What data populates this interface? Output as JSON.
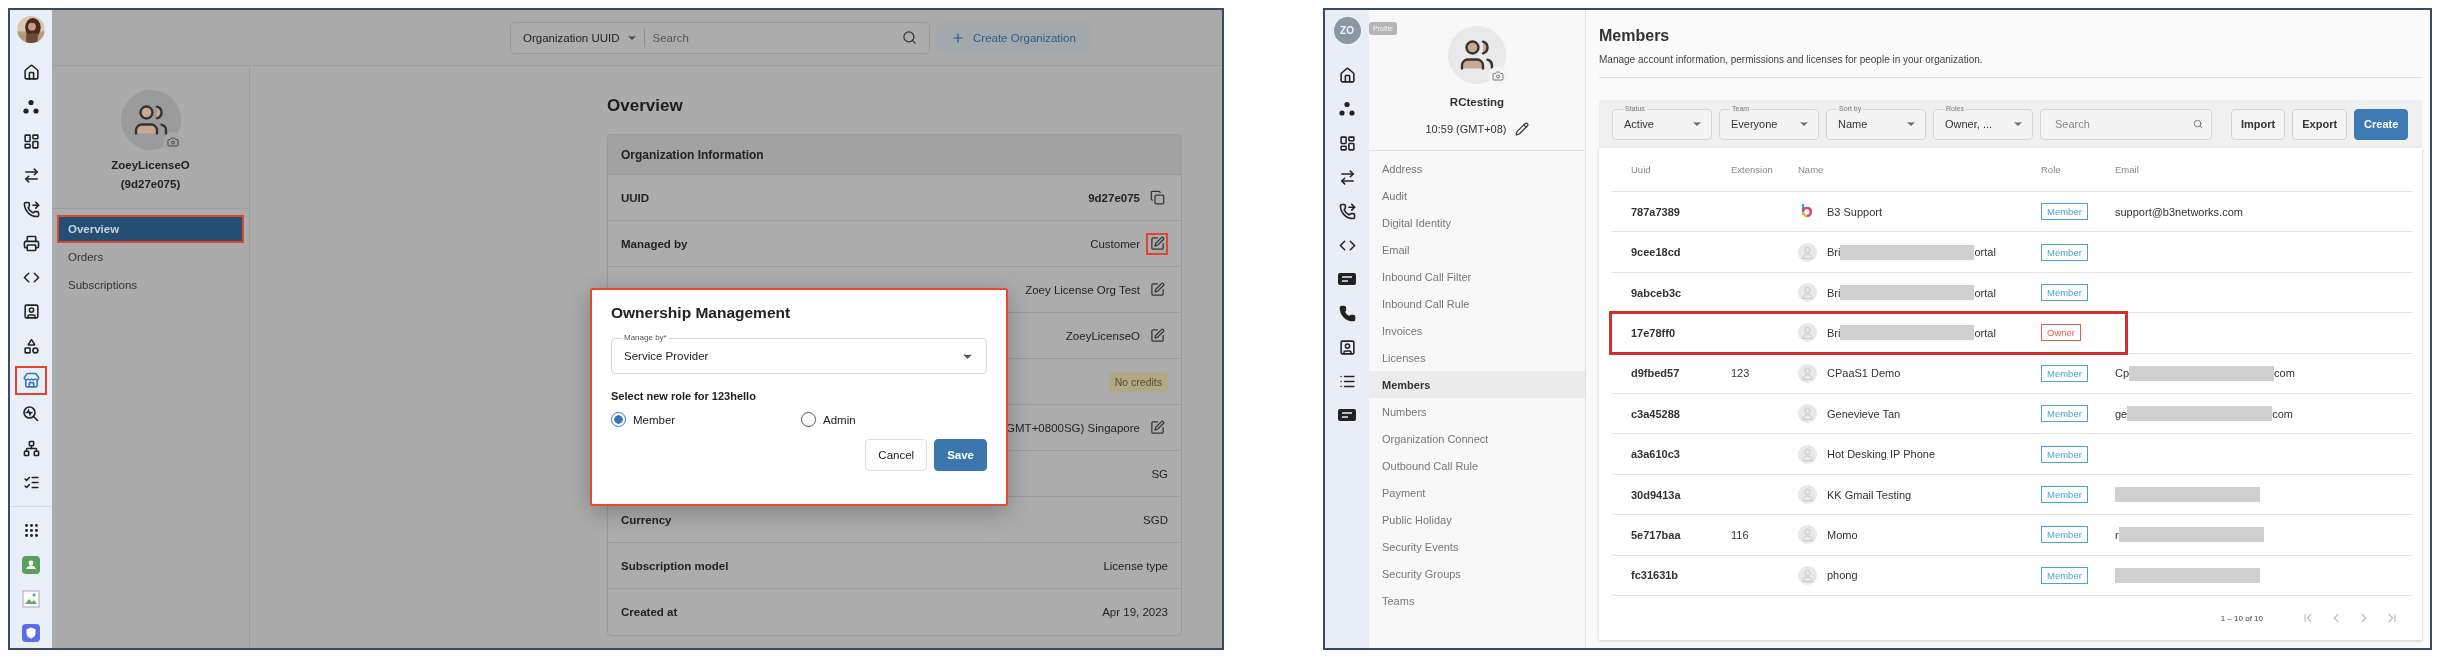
{
  "left_panel": {
    "rail": {
      "top": [
        {
          "kind": "home",
          "highlighted": false
        },
        {
          "kind": "dots",
          "highlighted": false
        },
        {
          "kind": "dashboard",
          "highlighted": false
        },
        {
          "kind": "arrows",
          "highlighted": false
        },
        {
          "kind": "phone",
          "highlighted": false
        },
        {
          "kind": "printer",
          "highlighted": false
        },
        {
          "kind": "code",
          "highlighted": false
        },
        {
          "kind": "contact",
          "highlighted": false
        },
        {
          "kind": "shapes",
          "highlighted": false
        },
        {
          "kind": "store",
          "highlighted": true
        },
        {
          "kind": "pulse-search",
          "highlighted": false
        },
        {
          "kind": "network",
          "highlighted": false
        },
        {
          "kind": "checklist",
          "highlighted": false
        }
      ],
      "bottom": [
        {
          "kind": "grid",
          "highlighted": false
        },
        {
          "kind": "app-green",
          "highlighted": false
        },
        {
          "kind": "broken-image",
          "highlighted": false
        },
        {
          "kind": "shield",
          "highlighted": false
        }
      ]
    },
    "search": {
      "scope": "Organization UUID",
      "placeholder": "Search"
    },
    "create_button": "Create Organization",
    "org": {
      "name": "ZoeyLicenseO",
      "id": "(9d27e075)"
    },
    "nav": [
      {
        "label": "Overview",
        "selected": true,
        "highlighted": true
      },
      {
        "label": "Orders",
        "selected": false,
        "highlighted": false
      },
      {
        "label": "Subscriptions",
        "selected": false,
        "highlighted": false
      }
    ],
    "title": "Overview",
    "card": {
      "title": "Organization Information",
      "rows": [
        {
          "label": "UUID",
          "kind": "copyable",
          "value": "9d27e075",
          "highlighted": false
        },
        {
          "label": "Managed by",
          "kind": "editable",
          "value": "Customer",
          "highlighted": true
        },
        {
          "kind": "editable",
          "value": "Zoey License Org Test",
          "highlighted": false
        },
        {
          "kind": "editable",
          "value": "ZoeyLicenseO",
          "highlighted": false
        },
        {
          "kind": "badge",
          "value": "No credits",
          "highlighted": false
        },
        {
          "kind": "editable",
          "value": "GMT+0800SG) Singapore",
          "highlighted": false
        },
        {
          "kind": "plain",
          "value": "SG",
          "highlighted": false
        },
        {
          "label": "Currency",
          "kind": "plain",
          "value": "SGD",
          "highlighted": false
        },
        {
          "label": "Subscription model",
          "kind": "plain",
          "value": "License type",
          "highlighted": false
        },
        {
          "label": "Created at",
          "kind": "plain",
          "value": "Apr 19, 2023",
          "highlighted": false
        }
      ]
    },
    "dialog": {
      "title": "Ownership Management",
      "highlighted": true,
      "field": {
        "label": "Manage by*",
        "value": "Service Provider"
      },
      "prompt": "Select new role for 123hello",
      "options": [
        {
          "label": "Member",
          "selected": true
        },
        {
          "label": "Admin",
          "selected": false
        }
      ],
      "buttons": [
        {
          "label": "Cancel",
          "kind": "secondary"
        },
        {
          "label": "Save",
          "kind": "primary"
        }
      ]
    }
  },
  "right_panel": {
    "avatar_initials": "ZO",
    "profile_tag": "Profile",
    "rail": [
      {
        "kind": "home"
      },
      {
        "kind": "dots"
      },
      {
        "kind": "dashboard"
      },
      {
        "kind": "arrows"
      },
      {
        "kind": "phone"
      },
      {
        "kind": "code"
      },
      {
        "kind": "tag"
      },
      {
        "kind": "telephone"
      },
      {
        "kind": "contact"
      },
      {
        "kind": "list"
      },
      {
        "kind": "tag"
      }
    ],
    "account": {
      "name": "RCtesting",
      "time": "10:59 (GMT+08)"
    },
    "nav": [
      {
        "label": "Address",
        "selected": false
      },
      {
        "label": "Audit",
        "selected": false
      },
      {
        "label": "Digital Identity",
        "selected": false
      },
      {
        "label": "Email",
        "selected": false
      },
      {
        "label": "Inbound Call Filter",
        "selected": false
      },
      {
        "label": "Inbound Call Rule",
        "selected": false
      },
      {
        "label": "Invoices",
        "selected": false
      },
      {
        "label": "Licenses",
        "selected": false
      },
      {
        "label": "Members",
        "selected": true
      },
      {
        "label": "Numbers",
        "selected": false
      },
      {
        "label": "Organization Connect",
        "selected": false
      },
      {
        "label": "Outbound Call Rule",
        "selected": false
      },
      {
        "label": "Payment",
        "selected": false
      },
      {
        "label": "Public Holiday",
        "selected": false
      },
      {
        "label": "Security Events",
        "selected": false
      },
      {
        "label": "Security Groups",
        "selected": false
      },
      {
        "label": "Teams",
        "selected": false
      }
    ],
    "title": "Members",
    "subtitle": "Manage account information, permissions and licenses for people in your organization.",
    "filters": [
      {
        "label": "Status",
        "value": "Active"
      },
      {
        "label": "Team",
        "value": "Everyone"
      },
      {
        "label": "Sort by",
        "value": "Name"
      },
      {
        "label": "Roles",
        "value": "Owner, ..."
      }
    ],
    "search": {
      "placeholder": "Search"
    },
    "buttons": [
      {
        "label": "Import",
        "kind": "secondary"
      },
      {
        "label": "Export",
        "kind": "secondary"
      },
      {
        "label": "Create",
        "kind": "primary"
      }
    ],
    "table": {
      "columns": [
        "Uuid",
        "Extension",
        "Name",
        "Role",
        "Email"
      ],
      "rows": [
        {
          "uuid": "787a7389",
          "kind": "logo",
          "name": "B3 Support",
          "role": {
            "label": "Member",
            "color": "#4ba3d3"
          },
          "email": "support@b3networks.com",
          "highlighted": false
        },
        {
          "uuid": "9cee18cd",
          "kind": "person",
          "name": "Bri",
          "name_after": "ortal",
          "name_redacted": true,
          "role": {
            "label": "Member",
            "color": "#4ba3d3"
          },
          "highlighted": false
        },
        {
          "uuid": "9abceb3c",
          "kind": "person",
          "name": "Bri",
          "name_after": "ortal",
          "name_redacted": true,
          "role": {
            "label": "Member",
            "color": "#4ba3d3"
          },
          "highlighted": false
        },
        {
          "uuid": "17e78ff0",
          "kind": "person",
          "name": "Bri",
          "name_after": "ortal",
          "name_redacted": true,
          "role": {
            "label": "Owner",
            "color": "#e0604f"
          },
          "highlighted": true
        },
        {
          "uuid": "d9fbed57",
          "extension": "123",
          "kind": "person",
          "name": "CPaaS1 Demo",
          "role": {
            "label": "Member",
            "color": "#4ba3d3"
          },
          "email": "Cp",
          "email_after": "com",
          "email_redacted": true,
          "highlighted": false
        },
        {
          "uuid": "c3a45288",
          "kind": "person",
          "name": "Genevieve Tan",
          "role": {
            "label": "Member",
            "color": "#4ba3d3"
          },
          "email": "ge",
          "email_after": "com",
          "email_redacted": true,
          "highlighted": false
        },
        {
          "uuid": "a3a610c3",
          "kind": "person",
          "name": "Hot Desking IP Phone",
          "role": {
            "label": "Member",
            "color": "#4ba3d3"
          },
          "highlighted": false
        },
        {
          "uuid": "30d9413a",
          "kind": "person",
          "name": "KK Gmail Testing",
          "role": {
            "label": "Member",
            "color": "#4ba3d3"
          },
          "email_redacted": true,
          "highlighted": false
        },
        {
          "uuid": "5e717baa",
          "extension": "116",
          "kind": "person",
          "name": "Momo",
          "role": {
            "label": "Member",
            "color": "#4ba3d3"
          },
          "email": "r",
          "email_redacted": true,
          "highlighted": false
        },
        {
          "uuid": "fc31631b",
          "kind": "person",
          "name": "phong",
          "role": {
            "label": "Member",
            "color": "#4ba3d3"
          },
          "email_redacted": true,
          "highlighted": false
        }
      ]
    },
    "pagination": {
      "range": "1 – 10 of 10"
    }
  }
}
